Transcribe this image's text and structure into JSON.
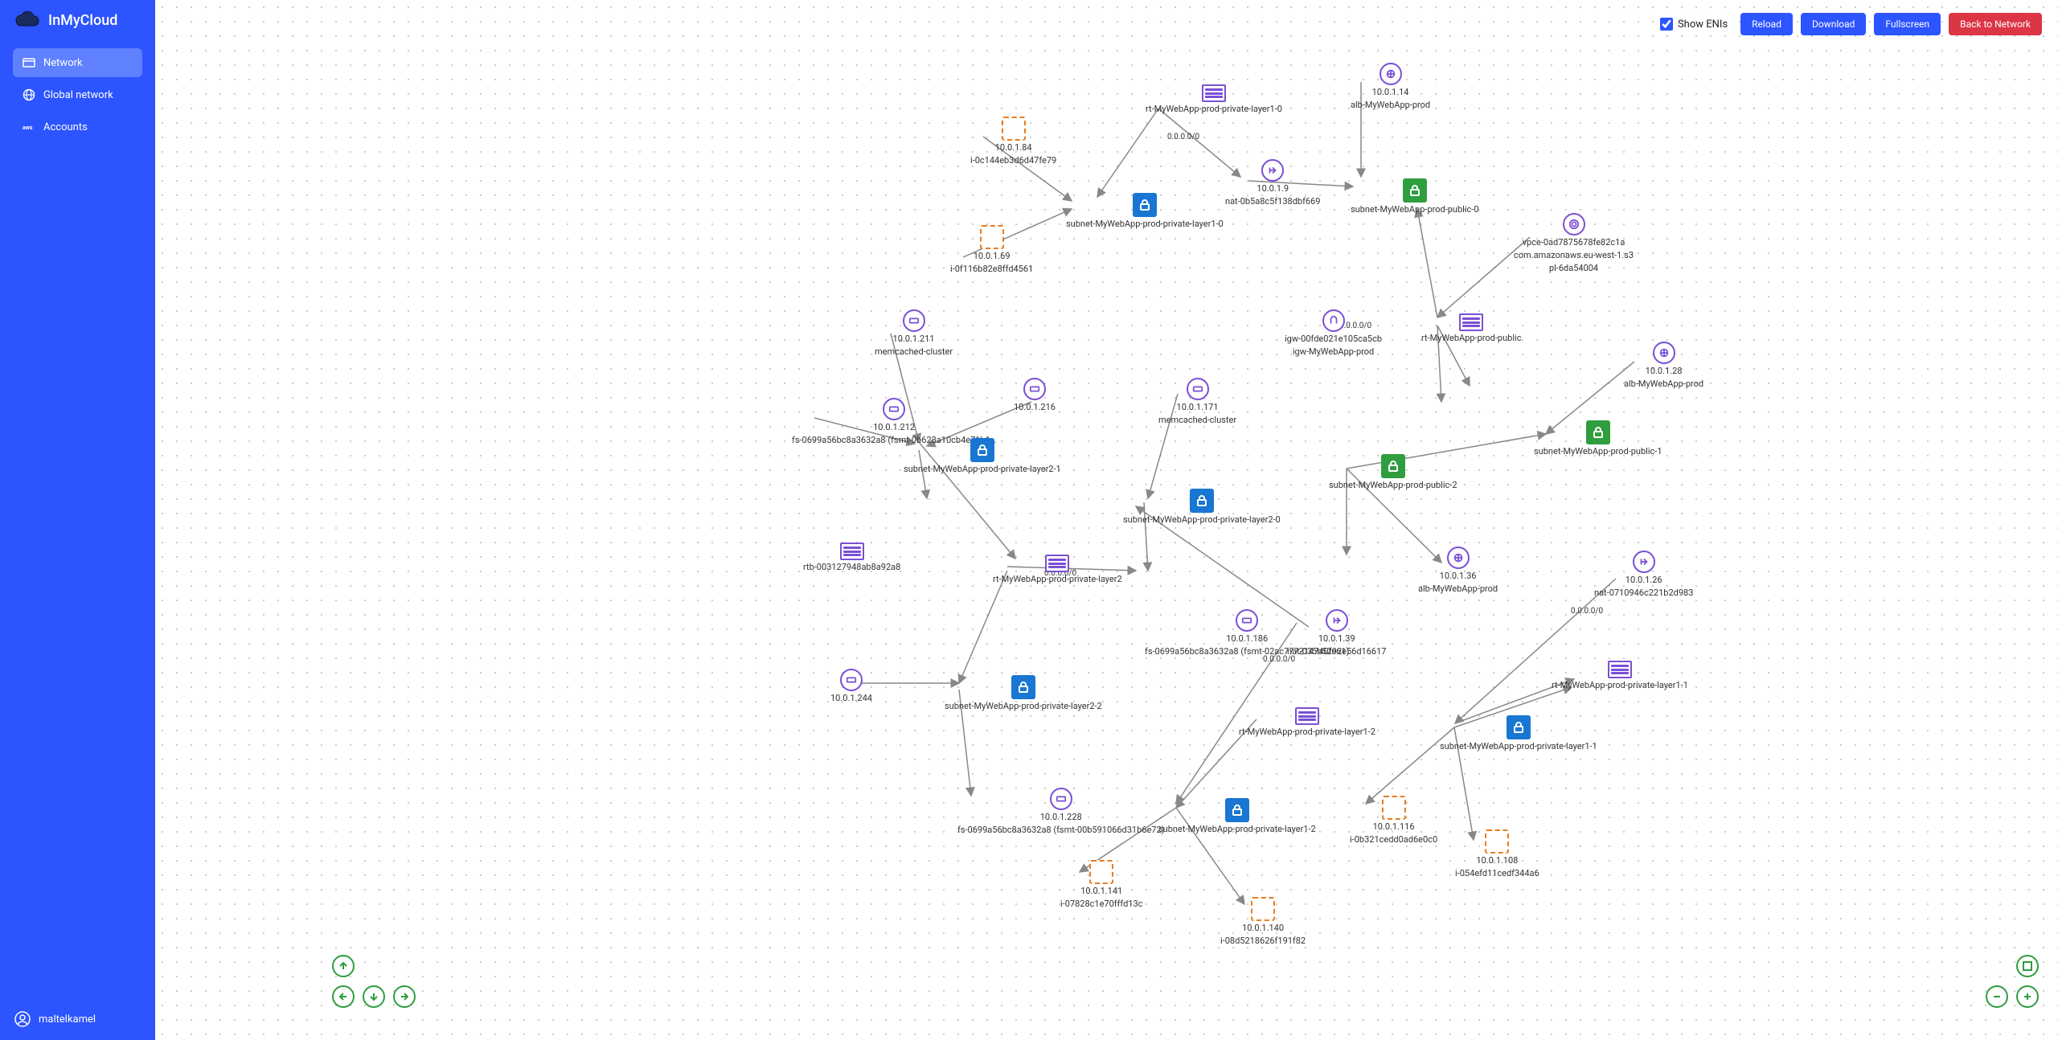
{
  "brand": "InMyCloud",
  "nav": {
    "network": "Network",
    "global": "Global network",
    "accounts": "Accounts"
  },
  "user": "maltelkamel",
  "toolbar": {
    "show_enis": "Show ENIs",
    "reload": "Reload",
    "download": "Download",
    "fullscreen": "Fullscreen",
    "back": "Back to Network"
  },
  "nodes": {
    "rt_l1_0": {
      "l1": "rt-MyWebApp-prod-private-layer1-0"
    },
    "i1": {
      "l1": "10.0.1.84",
      "l2": "i-0c144eb3d6d47fe79"
    },
    "i2": {
      "l1": "10.0.1.69",
      "l2": "i-0f116b82e8ffd4561"
    },
    "sn_l1_0": {
      "l1": "subnet-MyWebApp-prod-private-layer1-0"
    },
    "alb0": {
      "l1": "10.0.1.14",
      "l2": "alb-MyWebApp-prod"
    },
    "nat0": {
      "l1": "10.0.1.9",
      "l2": "nat-0b5a8c5f138dbf669"
    },
    "sn_pub0": {
      "l1": "subnet-MyWebApp-prod-public-0"
    },
    "vpce": {
      "l1": "vpce-0ad7875678fe82c1a",
      "l2": "com.amazonaws.eu-west-1.s3",
      "l3": "pl-6da54004"
    },
    "igw": {
      "l1": "igw-00fde021e105ca5cb",
      "l2": "igw-MyWebApp-prod"
    },
    "rt_pub": {
      "l1": "rt-MyWebApp-prod-public"
    },
    "alb1": {
      "l1": "10.0.1.28",
      "l2": "alb-MyWebApp-prod"
    },
    "mem0": {
      "l1": "10.0.1.211",
      "l2": "memcached-cluster"
    },
    "mem216": {
      "l1": "10.0.1.216"
    },
    "mem1": {
      "l1": "10.0.1.171",
      "l2": "memcached-cluster"
    },
    "fs0": {
      "l1": "10.0.1.212",
      "l2": "fs-0699a56bc8a3632a8 (fsmt-0b623a10cb4e71b1…"
    },
    "sn_l2_1": {
      "l1": "subnet-MyWebApp-prod-private-layer2-1"
    },
    "sn_l2_0": {
      "l1": "subnet-MyWebApp-prod-private-layer2-0"
    },
    "sn_pub2": {
      "l1": "subnet-MyWebApp-prod-public-2"
    },
    "sn_pub1": {
      "l1": "subnet-MyWebApp-prod-public-1"
    },
    "rtb": {
      "l1": "rtb-003127948ab8a92a8"
    },
    "rt_l2": {
      "l1": "rt-MyWebApp-prod-private-layer2"
    },
    "alb2": {
      "l1": "10.0.1.36",
      "l2": "alb-MyWebApp-prod"
    },
    "nat1": {
      "l1": "10.0.1.26",
      "l2": "nat-0710946c221b2d983"
    },
    "nat2": {
      "l1": "10.0.1.39",
      "l2": "nat-035b5292e56d16617"
    },
    "fs1": {
      "l1": "10.0.1.186",
      "l2": "fs-0699a56bc8a3632a8 (fsmt-02ac777214740fe61)"
    },
    "c244": {
      "l1": "10.0.1.244"
    },
    "sn_l2_2": {
      "l1": "subnet-MyWebApp-prod-private-layer2-2"
    },
    "rt_l1_2": {
      "l1": "rt-MyWebApp-prod-private-layer1-2"
    },
    "sn_l1_1": {
      "l1": "subnet-MyWebApp-prod-private-layer1-1"
    },
    "rt_l1_1": {
      "l1": "rt-MyWebApp-prod-private-layer1-1"
    },
    "fs2": {
      "l1": "10.0.1.228",
      "l2": "fs-0699a56bc8a3632a8 (fsmt-00b591066d31b6e72)"
    },
    "sn_l1_2": {
      "l1": "subnet-MyWebApp-prod-private-layer1-2"
    },
    "i3": {
      "l1": "10.0.1.116",
      "l2": "i-0b321cedd0ad6e0c0"
    },
    "i4": {
      "l1": "10.0.1.108",
      "l2": "i-054efd11cedf344a6"
    },
    "i5": {
      "l1": "10.0.1.141",
      "l2": "i-07828c1e70fffd13c"
    },
    "i6": {
      "l1": "10.0.1.140",
      "l2": "i-08d5218626f191f82"
    }
  },
  "edge_labels": {
    "e1": "0.0.0.0/0",
    "e2": "0.0.0.0/0",
    "e3": "0.0.0.0/0",
    "e4": "0.0.0.0/0",
    "e5": "0.0.0.0/0"
  }
}
